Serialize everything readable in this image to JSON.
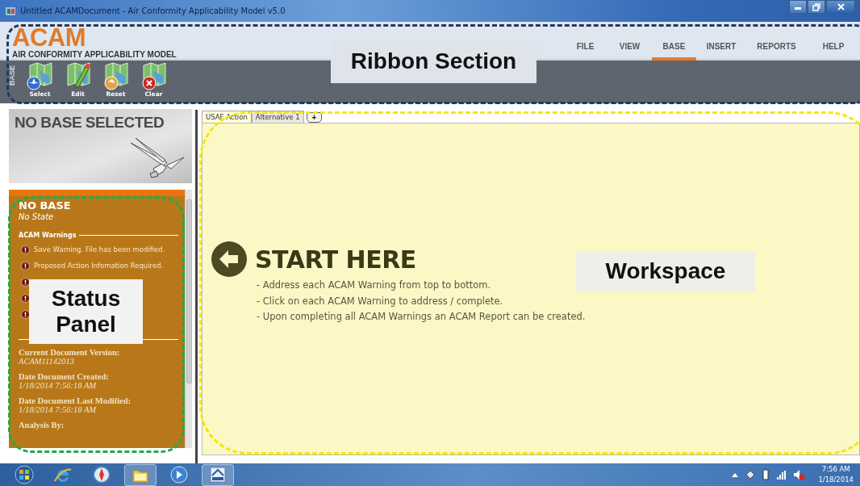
{
  "window": {
    "title": "Untitled ACAMDocument - Air Conformity Applicability Model v5.0"
  },
  "ribbon": {
    "logo": "ACAM",
    "subtitle": "AIR CONFORMITY APPLICABILITY MODEL",
    "menu": [
      {
        "label": "FILE",
        "selected": false
      },
      {
        "label": "VIEW",
        "selected": false
      },
      {
        "label": "BASE",
        "selected": true
      },
      {
        "label": "INSERT",
        "selected": false
      },
      {
        "label": "REPORTS",
        "selected": false
      },
      {
        "label": "HELP",
        "selected": false
      }
    ],
    "group_label": "BASE",
    "tools": [
      {
        "label": "Select",
        "kind": "select"
      },
      {
        "label": "Edit",
        "kind": "edit"
      },
      {
        "label": "Reset",
        "kind": "reset"
      },
      {
        "label": "Clear",
        "kind": "clear"
      }
    ]
  },
  "base_banner": {
    "title": "NO BASE SELECTED"
  },
  "status_panel": {
    "base_name": "NO BASE",
    "state": "No State",
    "warnings_heading": "ACAM Warnings",
    "warnings": [
      {
        "kind": "full",
        "text": "Save Warning. File has been modified."
      },
      {
        "kind": "full",
        "text": "Proposed Action Infomation Required."
      },
      {
        "kind": "icon_only"
      },
      {
        "kind": "icon_only"
      },
      {
        "kind": "icon_only"
      }
    ],
    "document_fields": [
      {
        "label": "Current Document Version:",
        "value": "ACAM11142013"
      },
      {
        "label": "Date Document Created:",
        "value": "1/18/2014 7:56:18 AM"
      },
      {
        "label": "Date Document Last Modified:",
        "value": "1/18/2014 7:56:18 AM"
      },
      {
        "label": "Analysis By:"
      }
    ]
  },
  "workspace": {
    "tabs": [
      {
        "label": "USAF Action",
        "selected": true
      },
      {
        "label": "Alternative 1",
        "selected": false
      }
    ],
    "add_tab": "+",
    "heading": "START HERE",
    "instructions": [
      "- Address each ACAM Warning from top to bottom.",
      "- Click on each ACAM Warning to address / complete.",
      "- Upon completing all ACAM Warnings an ACAM Report can be created."
    ]
  },
  "taskbar": {
    "apps": [
      {
        "kind": "start",
        "running": false
      },
      {
        "kind": "ie",
        "running": false
      },
      {
        "kind": "compass",
        "running": false
      },
      {
        "kind": "folder",
        "running": true
      },
      {
        "kind": "media",
        "running": false
      },
      {
        "kind": "acam",
        "running": true
      }
    ],
    "clock": {
      "time": "7:56 AM",
      "date": "1/18/2014"
    }
  },
  "annotations": [
    {
      "label": "Ribbon Section",
      "color": "#1f3b63"
    },
    {
      "label": "Status Panel",
      "color": "#1faa4a"
    },
    {
      "label": "Workspace",
      "color": "#f5e800"
    }
  ]
}
